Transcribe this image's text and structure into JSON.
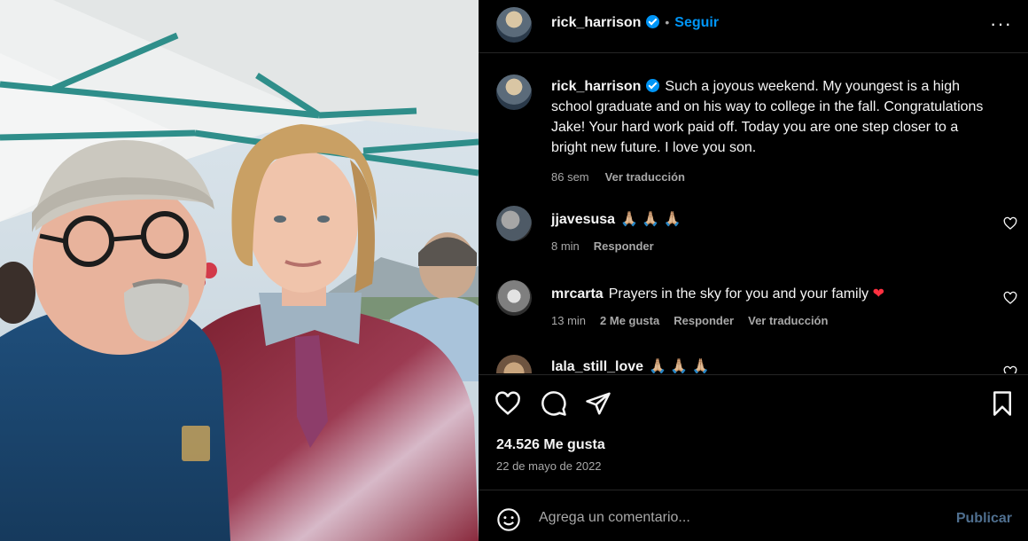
{
  "post": {
    "author": "rick_harrison",
    "follow_label": "Seguir",
    "separator": "•",
    "more_label": "···",
    "photo_badge": "NAU"
  },
  "caption": {
    "author": "rick_harrison",
    "text": "Such a joyous weekend. My youngest is a high school graduate and on his way to college in the fall. Congratulations Jake! Your hard work paid off. Today you are one step closer to a bright new future. I love you son.",
    "time": "86 sem",
    "translate": "Ver traducción"
  },
  "comments": [
    {
      "user": "jjavesusa",
      "text": "🙏🏼 🙏🏼 🙏🏼",
      "time": "8 min",
      "likes": "",
      "reply": "Responder",
      "translate": ""
    },
    {
      "user": "mrcarta",
      "text": "Prayers in the sky for you and your family ❤️",
      "time": "13 min",
      "likes": "2 Me gusta",
      "reply": "Responder",
      "translate": "Ver traducción"
    },
    {
      "user": "lala_still_love",
      "text": "🙏🏼 🙏🏼 🙏🏼",
      "time": "",
      "likes": "",
      "reply": "",
      "translate": ""
    }
  ],
  "actions": {
    "icons": [
      "heart-icon",
      "comment-icon",
      "share-icon",
      "bookmark-icon"
    ]
  },
  "likes_label": "24.526 Me gusta",
  "date_label": "22 de mayo de 2022",
  "add_comment": {
    "placeholder": "Agrega un comentario...",
    "publish_label": "Publicar"
  },
  "colors": {
    "background": "#000000",
    "accent": "#0095f6",
    "muted": "#a8a8a8",
    "like_red": "#ff3040"
  }
}
